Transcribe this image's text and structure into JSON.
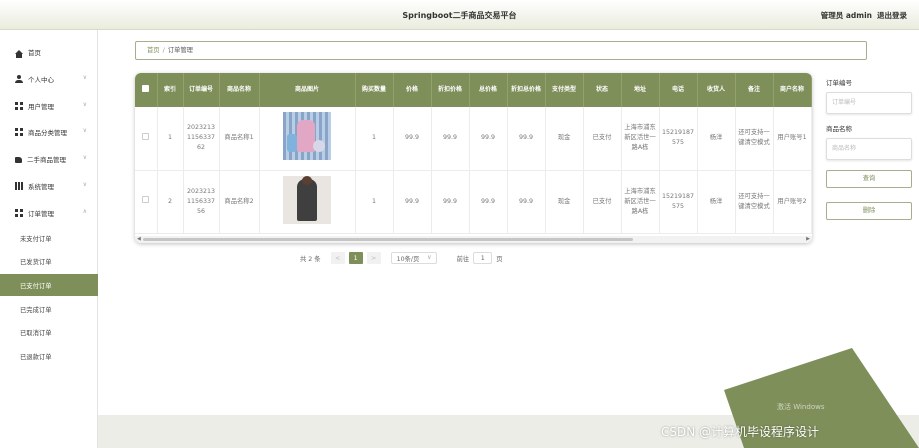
{
  "header": {
    "title": "Springboot二手商品交易平台",
    "user": "管理员 admin",
    "logout": "退出登录"
  },
  "sidebar": {
    "items": [
      {
        "label": "首页",
        "icon": "home-icon",
        "has_chevron": false
      },
      {
        "label": "个人中心",
        "icon": "user-icon",
        "has_chevron": true
      },
      {
        "label": "用户管理",
        "icon": "grid-icon",
        "has_chevron": true
      },
      {
        "label": "商品分类管理",
        "icon": "grid-icon",
        "has_chevron": true
      },
      {
        "label": "二手商品管理",
        "icon": "thumb-icon",
        "has_chevron": true
      },
      {
        "label": "系统管理",
        "icon": "apps-icon",
        "has_chevron": true
      },
      {
        "label": "订单管理",
        "icon": "grid-icon",
        "has_chevron": true,
        "expanded": true
      }
    ],
    "submenu": [
      "未支付订单",
      "已发货订单",
      "已支付订单",
      "已完成订单",
      "已取消订单",
      "已退款订单"
    ],
    "active_submenu": "已支付订单"
  },
  "breadcrumb": {
    "home": "首页",
    "current": "订单管理"
  },
  "table": {
    "columns": [
      "索引",
      "订单编号",
      "商品名称",
      "商品图片",
      "购买数量",
      "价格",
      "折扣价格",
      "总价格",
      "折扣总价格",
      "支付类型",
      "状态",
      "地址",
      "电话",
      "收货人",
      "备注",
      "商户名称"
    ],
    "rows": [
      {
        "index": "1",
        "order_no": "20232131156337 62",
        "name": "商品名称1",
        "image": "product-image-1",
        "qty": "1",
        "price": "99.9",
        "discount_price": "99.9",
        "total": "99.9",
        "discount_total": "99.9",
        "pay_type": "现金",
        "status": "已支付",
        "address": "上海市浦东新区活世一路A栋",
        "phone": "15219187575",
        "receiver": "杨洋",
        "remark": "还可支持一键清空模式",
        "merchant": "用户账号1"
      },
      {
        "index": "2",
        "order_no": "20232131156337 56",
        "name": "商品名称2",
        "image": "product-image-2",
        "qty": "1",
        "price": "99.9",
        "discount_price": "99.9",
        "total": "99.9",
        "discount_total": "99.9",
        "pay_type": "现金",
        "status": "已支付",
        "address": "上海市浦东新区活世一路A栋",
        "phone": "15219187575",
        "receiver": "杨洋",
        "remark": "还可支持一键清空模式",
        "merchant": "用户账号2"
      }
    ]
  },
  "pagination": {
    "total": "共 2 条",
    "prev": "<",
    "page": "1",
    "next": ">",
    "page_size": "10条/页",
    "goto_prefix": "前往",
    "goto_value": "1",
    "goto_suffix": "页"
  },
  "search": {
    "order_no_label": "订单编号",
    "order_no_placeholder": "订单编号",
    "name_label": "商品名称",
    "name_placeholder": "商品名称",
    "query_button": "查询",
    "delete_button": "删除"
  },
  "overlay": {
    "watermark": "激活 Windows",
    "csdn": "CSDN @计算机毕设程序设计"
  },
  "colors": {
    "accent": "#7f8f5a",
    "header_bg": "#e9ecdd"
  }
}
